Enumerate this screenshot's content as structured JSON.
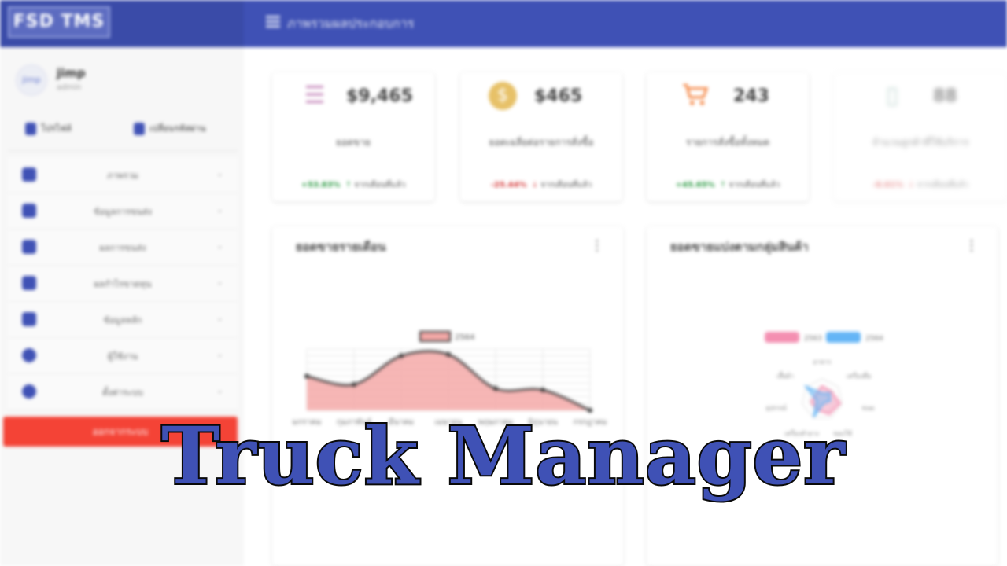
{
  "app": {
    "logo_text": "FSD TMS",
    "page_title": "ภาพรวมผลประกอบการ",
    "overlay_title": "Truck Manager"
  },
  "user": {
    "name": "jimp",
    "role": "admin",
    "avatar_text": "jimp",
    "actions": [
      "โปรไฟล์",
      "เปลี่ยนรหัสผ่าน"
    ]
  },
  "sidebar": {
    "items": [
      {
        "label": "ภาพรวม",
        "icon": "dashboard-icon"
      },
      {
        "label": "ข้อมูลการขนส่ง",
        "icon": "truck-icon"
      },
      {
        "label": "ผลการขนส่ง",
        "icon": "document-icon"
      },
      {
        "label": "ผลกำไรขาดทุน",
        "icon": "document-icon"
      },
      {
        "label": "ข้อมูลหลัก",
        "icon": "document-icon"
      },
      {
        "label": "ผู้ใช้งาน",
        "icon": "user-icon"
      },
      {
        "label": "ตั้งค่าระบบ",
        "icon": "settings-icon"
      }
    ],
    "logout_label": "ออกจากระบบ"
  },
  "kpis": [
    {
      "icon": "list-icon",
      "icon_color": "#c485b9",
      "value": "$9,465",
      "label": "ยอดขาย",
      "change": "+53.83%",
      "trend": "up",
      "note": "จากเดือนที่แล้ว"
    },
    {
      "icon": "coin-icon",
      "icon_color": "#e7c168",
      "value": "$465",
      "label": "ยอดเฉลี่ยต่อรายการสั่งซื้อ",
      "change": "-25.44%",
      "trend": "down",
      "note": "จากเดือนที่แล้ว"
    },
    {
      "icon": "cart-icon",
      "icon_color": "#f58a4a",
      "value": "243",
      "label": "รายการสั่งซื้อทั้งหมด",
      "change": "+45.65%",
      "trend": "up",
      "note": "จากเดือนที่แล้ว"
    },
    {
      "icon": "box-icon",
      "icon_color": "#8fb7ae",
      "value": "88",
      "label": "จำนวนลูกค้าที่ใช้บริการ",
      "change": "-8.61%",
      "trend": "down",
      "note": "จากเดือนที่แล้ว"
    }
  ],
  "colors": {
    "primary": "#3f51b5",
    "danger": "#f44336",
    "line_fill": "#f4a9a8",
    "line_stroke": "#333333",
    "up": "#2e9b45",
    "down": "#d53b3b",
    "radar_a": "#f48fb1",
    "radar_b": "#64b5f6"
  },
  "chart_data": [
    {
      "type": "area",
      "title": "ยอดขายรายเดือน",
      "legend": [
        "2564"
      ],
      "legend_position": "top",
      "categories": [
        "มกราคม",
        "กุมภาพันธ์",
        "มีนาคม",
        "เมษายน",
        "พฤษภาคม",
        "มิถุนายน",
        "กรกฎาคม"
      ],
      "series": [
        {
          "name": "2564",
          "values": [
            65,
            59,
            80,
            81,
            56,
            55,
            40
          ]
        }
      ],
      "ylim": [
        40,
        85
      ],
      "grid": true
    },
    {
      "type": "radar",
      "title": "ยอดขายแบ่งตามกลุ่มสินค้า",
      "legend": [
        "2563",
        "2564"
      ],
      "legend_position": "top",
      "categories": [
        "อาหาร",
        "เครื่องดื่ม",
        "ขนม",
        "ของใช้",
        "เครื่องสำอาง",
        "อุปกรณ์",
        "เสื้อผ้า"
      ],
      "series": [
        {
          "name": "2563",
          "values": [
            65,
            59,
            90,
            81,
            56,
            55,
            40
          ]
        },
        {
          "name": "2564",
          "values": [
            28,
            48,
            40,
            19,
            96,
            27,
            100
          ]
        }
      ]
    }
  ]
}
